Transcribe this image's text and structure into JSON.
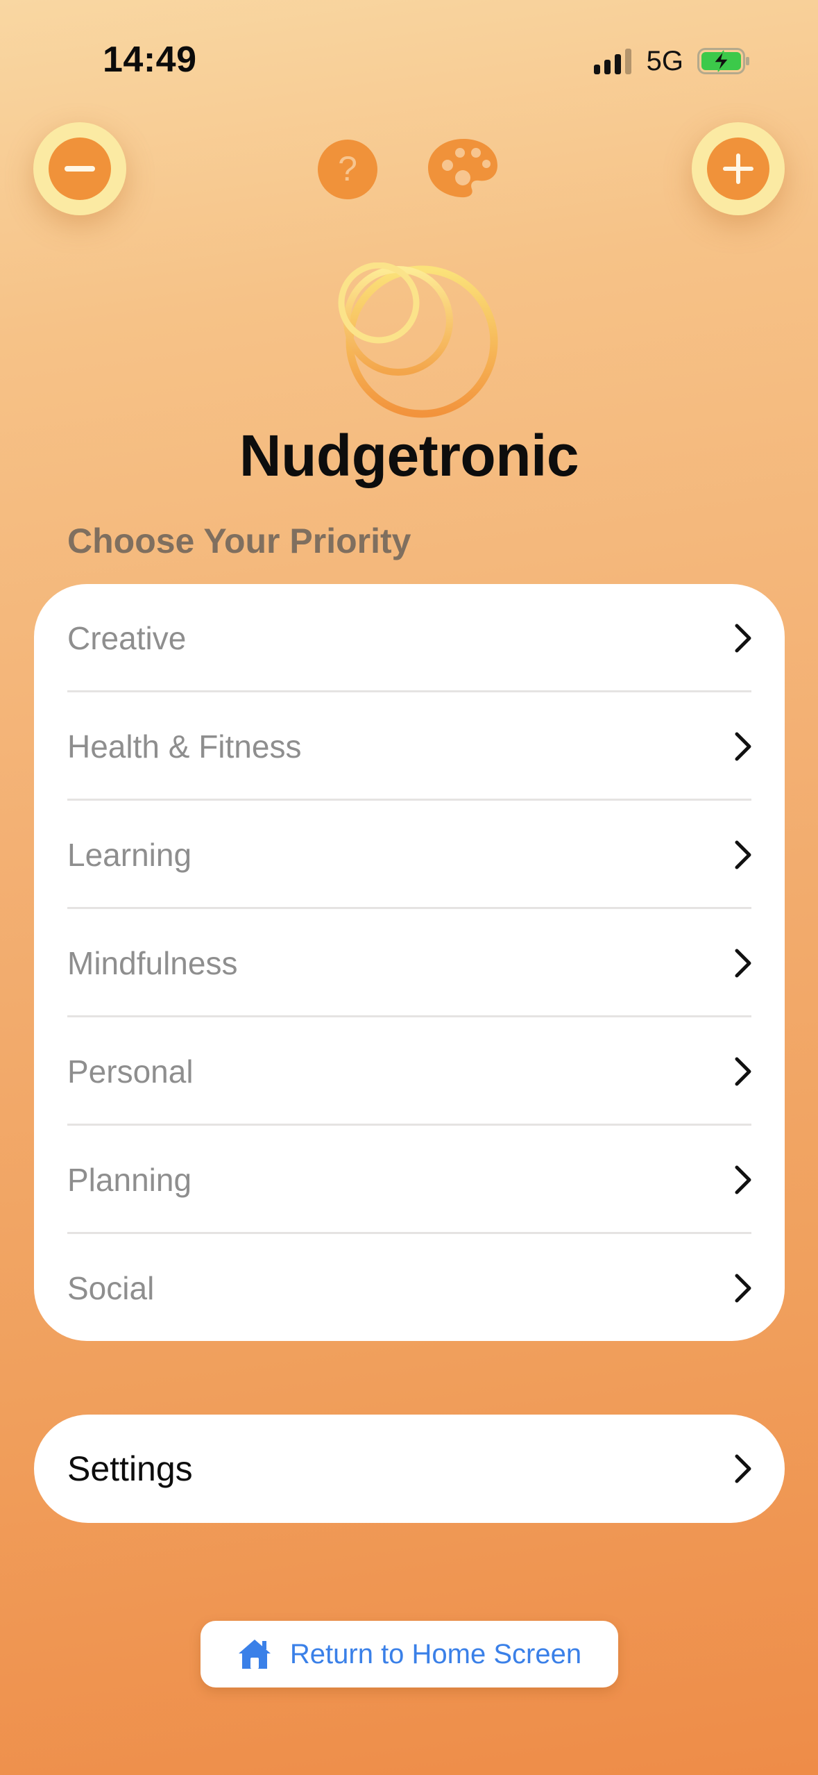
{
  "status_bar": {
    "time": "14:49",
    "network": "5G",
    "icons": [
      "cellular-signal-icon",
      "battery-charging-icon"
    ]
  },
  "toolbar": {
    "icons": [
      "minus-icon",
      "help-icon",
      "palette-icon",
      "plus-icon"
    ],
    "help_glyph": "?"
  },
  "header": {
    "title": "Nudgetronic",
    "logo": "rings-logo"
  },
  "priority_section": {
    "label": "Choose Your Priority",
    "items": [
      {
        "label": "Creative"
      },
      {
        "label": "Health & Fitness"
      },
      {
        "label": "Learning"
      },
      {
        "label": "Mindfulness"
      },
      {
        "label": "Personal"
      },
      {
        "label": "Planning"
      },
      {
        "label": "Social"
      }
    ]
  },
  "settings": {
    "label": "Settings"
  },
  "home_button": {
    "label": "Return to Home Screen",
    "icon": "house-icon"
  },
  "colors": {
    "accent": "#f0923a",
    "button_halo": "#fbeaa3",
    "link_blue": "#3a80e8",
    "label_gray": "#8e8e8e",
    "section_label": "#7f6f5f"
  }
}
